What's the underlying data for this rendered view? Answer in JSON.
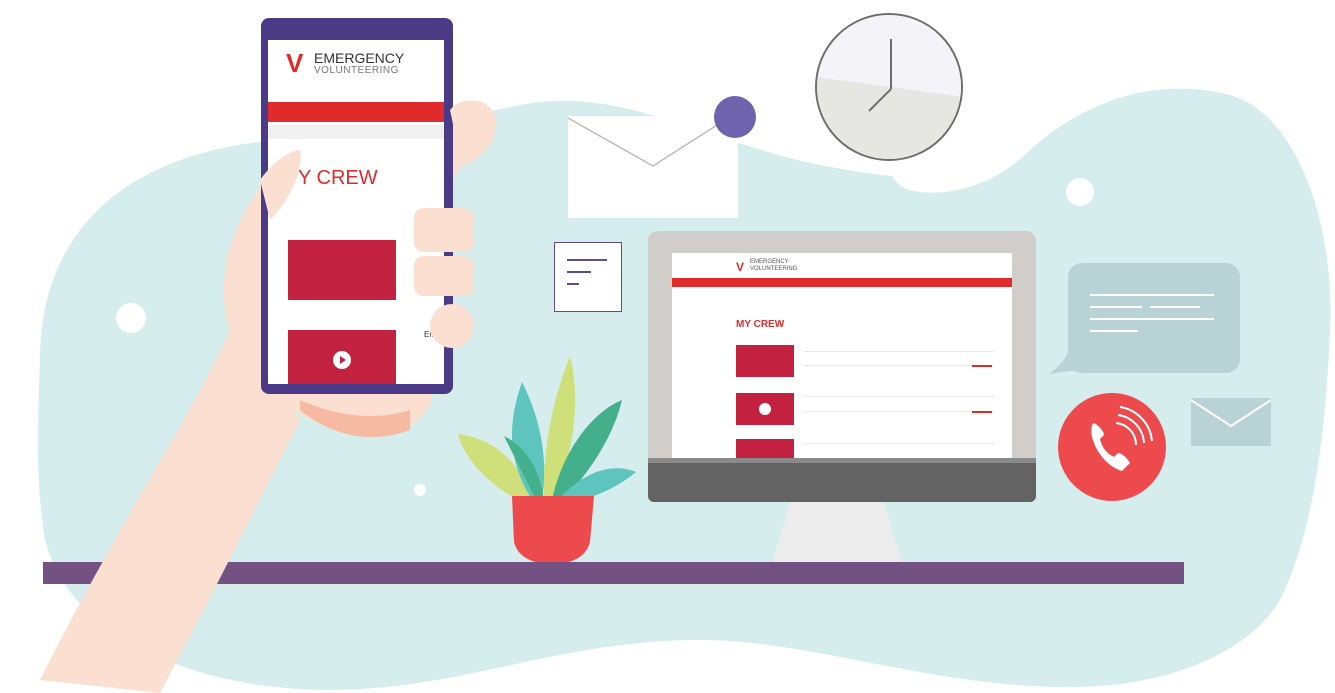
{
  "colors": {
    "blob": "#d5eeed",
    "phone_frame": "#4b3a86",
    "brand_red": "#e02b2b",
    "card_crimson": "#c2223f",
    "shelf": "#735182",
    "skin": "#fbe0d1",
    "skin_shadow": "#f6b9a2",
    "pot": "#ec4a4c",
    "call_circle": "#ec4a4c",
    "bubble": "#b9d2d6",
    "dot_purple": "#6f63ad"
  },
  "phone": {
    "logo_mark": "V",
    "logo_text": "EMERGENCY",
    "logo_sub": "VOLUNTEERING",
    "title": "Y CREW",
    "side_text": "Emi"
  },
  "laptop": {
    "logo_mark": "V",
    "logo_text": "EMERGENCY",
    "logo_sub": "VOLUNTEERING",
    "title": "MY CREW"
  },
  "icons": {
    "clock": "clock-icon",
    "envelope": "envelope-icon",
    "document": "document-icon",
    "chat": "chat-bubble-icon",
    "call": "phone-call-icon",
    "mail": "mail-icon",
    "plant": "plant-icon",
    "play": "play-icon"
  }
}
